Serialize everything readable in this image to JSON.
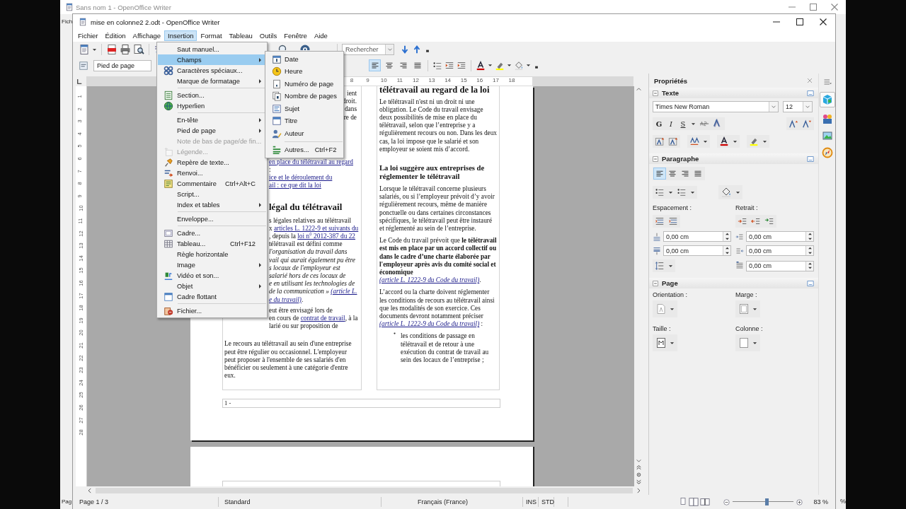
{
  "background_window": {
    "title": "Sans nom 1 - OpenOffice Writer",
    "menu_fragment": "Fich",
    "status_fragment": "Pag",
    "zoom_fragment": "%"
  },
  "window": {
    "title": "mise en colonne2 2.odt - OpenOffice Writer"
  },
  "menubar": [
    {
      "label": "Fichier",
      "selected": false
    },
    {
      "label": "Édition",
      "selected": false
    },
    {
      "label": "Affichage",
      "selected": false
    },
    {
      "label": "Insertion",
      "selected": true
    },
    {
      "label": "Format",
      "selected": false
    },
    {
      "label": "Tableau",
      "selected": false
    },
    {
      "label": "Outils",
      "selected": false
    },
    {
      "label": "Fenêtre",
      "selected": false
    },
    {
      "label": "Aide",
      "selected": false
    }
  ],
  "toolbar": {
    "paragraph_style": "Pied de page",
    "search": {
      "placeholder": "Rechercher"
    },
    "alignment": [
      {
        "selected": true
      },
      {
        "selected": false
      },
      {
        "selected": false
      },
      {
        "selected": false
      }
    ]
  },
  "insert_menu": [
    {
      "kind": "item",
      "label": "Saut manuel...",
      "icon": false,
      "selected": false,
      "disabled": false
    },
    {
      "kind": "submenu",
      "label": "Champs",
      "icon": false,
      "selected": true,
      "disabled": false
    },
    {
      "kind": "item",
      "label": "Caractères spéciaux...",
      "icon": true,
      "selected": false,
      "disabled": false
    },
    {
      "kind": "submenu",
      "label": "Marque de formatage",
      "icon": false,
      "selected": false,
      "disabled": false
    },
    {
      "kind": "separator"
    },
    {
      "kind": "item",
      "label": "Section...",
      "icon": true,
      "selected": false,
      "disabled": false
    },
    {
      "kind": "item",
      "label": "Hyperlien",
      "icon": true,
      "selected": false,
      "disabled": false
    },
    {
      "kind": "separator"
    },
    {
      "kind": "submenu",
      "label": "En-tête",
      "icon": false,
      "selected": false,
      "disabled": false
    },
    {
      "kind": "submenu",
      "label": "Pied de page",
      "icon": false,
      "selected": false,
      "disabled": false
    },
    {
      "kind": "item",
      "label": "Note de bas de page/de fin...",
      "icon": false,
      "selected": false,
      "disabled": true
    },
    {
      "kind": "item",
      "label": "Légende...",
      "icon": true,
      "selected": false,
      "disabled": true
    },
    {
      "kind": "item",
      "label": "Repère de texte...",
      "icon": true,
      "selected": false,
      "disabled": false
    },
    {
      "kind": "item",
      "label": "Renvoi...",
      "icon": true,
      "selected": false,
      "disabled": false
    },
    {
      "kind": "item",
      "label": "Commentaire",
      "shortcut": "Ctrl+Alt+C",
      "icon": true,
      "selected": false,
      "disabled": false
    },
    {
      "kind": "item",
      "label": "Script...",
      "icon": false,
      "selected": false,
      "disabled": false
    },
    {
      "kind": "submenu",
      "label": "Index et tables",
      "icon": false,
      "selected": false,
      "disabled": false
    },
    {
      "kind": "separator"
    },
    {
      "kind": "item",
      "label": "Enveloppe...",
      "icon": false,
      "selected": false,
      "disabled": false
    },
    {
      "kind": "separator"
    },
    {
      "kind": "item",
      "label": "Cadre...",
      "icon": true,
      "selected": false,
      "disabled": false
    },
    {
      "kind": "item",
      "label": "Tableau...",
      "shortcut": "Ctrl+F12",
      "icon": true,
      "selected": false,
      "disabled": false
    },
    {
      "kind": "item",
      "label": "Règle horizontale",
      "icon": false,
      "selected": false,
      "disabled": false
    },
    {
      "kind": "submenu",
      "label": "Image",
      "icon": false,
      "selected": false,
      "disabled": false
    },
    {
      "kind": "item",
      "label": "Vidéo et son...",
      "icon": true,
      "selected": false,
      "disabled": false
    },
    {
      "kind": "submenu",
      "label": "Objet",
      "icon": false,
      "selected": false,
      "disabled": false
    },
    {
      "kind": "item",
      "label": "Cadre flottant",
      "icon": true,
      "selected": false,
      "disabled": false
    },
    {
      "kind": "separator"
    },
    {
      "kind": "item",
      "label": "Fichier...",
      "icon": true,
      "selected": false,
      "disabled": false
    }
  ],
  "fields_menu": [
    {
      "kind": "item",
      "label": "Date",
      "icon": true,
      "selected": false,
      "disabled": false
    },
    {
      "kind": "item",
      "label": "Heure",
      "icon": true,
      "selected": false,
      "disabled": false
    },
    {
      "kind": "item",
      "label": "Numéro de page",
      "icon": true,
      "selected": false,
      "disabled": false
    },
    {
      "kind": "item",
      "label": "Nombre de pages",
      "icon": true,
      "selected": false,
      "disabled": false
    },
    {
      "kind": "item",
      "label": "Sujet",
      "icon": true,
      "selected": false,
      "disabled": false
    },
    {
      "kind": "item",
      "label": "Titre",
      "icon": true,
      "selected": false,
      "disabled": false
    },
    {
      "kind": "item",
      "label": "Auteur",
      "icon": true,
      "selected": false,
      "disabled": false
    },
    {
      "kind": "separator"
    },
    {
      "kind": "item",
      "label": "Autres...",
      "shortcut": "Ctrl+F2",
      "icon": true,
      "selected": false,
      "disabled": false
    }
  ],
  "ruler": {
    "labels": [
      "8",
      "9",
      "10",
      "11",
      "12",
      "13",
      "14",
      "15",
      "16",
      "17",
      "18"
    ]
  },
  "vertical_ruler": {
    "labels": [
      "1",
      "2",
      "3",
      "4",
      "5",
      "6",
      "7",
      "8",
      "9",
      "10",
      "11",
      "12",
      "13",
      "14",
      "15",
      "16",
      "17",
      "18",
      "19",
      "20",
      "21",
      "22",
      "23",
      "24",
      "25",
      "26",
      "27",
      "28"
    ]
  },
  "document": {
    "left_column": [
      {
        "kind": "fragment_right",
        "lines": [
          [
            {
              "text": "ient",
              "kind": "plain"
            }
          ],
          [
            {
              "text": "droit.",
              "kind": "plain"
            }
          ],
          [
            {
              "text": "dans",
              "kind": "plain"
            }
          ],
          [
            {
              "text": "re de",
              "kind": "plain"
            }
          ]
        ]
      },
      {
        "kind": "fragment_left",
        "lines": [
          [
            {
              "text": "en place du télétravail au regard",
              "kind": "link"
            }
          ],
          [
            {
              "text": ":",
              "kind": "plain"
            }
          ],
          [
            {
              "text": "ice et le déroulement du",
              "kind": "link"
            }
          ],
          [
            {
              "text": "ail : ce que dit la loi",
              "kind": "link"
            }
          ]
        ]
      },
      {
        "kind": "heading_fragment",
        "lines": [
          [
            {
              "text": "légal du télétravail",
              "kind": "plain"
            }
          ]
        ]
      },
      {
        "kind": "fragment_left",
        "lines": [
          [
            {
              "text": "s légales relatives au télétravail",
              "kind": "plain"
            }
          ],
          [
            {
              "text": "x ",
              "kind": "plain"
            },
            {
              "text": "articles L. 1222-9 et suivants du",
              "kind": "link"
            }
          ],
          [
            {
              "text": ", depuis la ",
              "kind": "plain"
            },
            {
              "text": "loi n° 2012-387 du 22",
              "kind": "link"
            }
          ],
          [
            {
              "text": "télétravail est défini comme",
              "kind": "plain"
            }
          ],
          [
            {
              "text": "l'organisation du travail dans",
              "kind": "italic"
            }
          ],
          [
            {
              "text": "vail qui aurait également pu être",
              "kind": "italic"
            }
          ],
          [
            {
              "text": "s locaux de l'employeur est",
              "kind": "italic"
            }
          ],
          [
            {
              "text": "salarié hors de ces locaux de",
              "kind": "italic"
            }
          ],
          [
            {
              "text": "e en utilisant les technologies de",
              "kind": "italic"
            }
          ],
          [
            {
              "text": "de la communication » ",
              "kind": "italic"
            },
            {
              "text": "(article L.",
              "kind": "italic_link"
            }
          ],
          [
            {
              "text": "e du travail)",
              "kind": "italic_link"
            },
            {
              "text": ".",
              "kind": "plain"
            }
          ]
        ]
      },
      {
        "kind": "fragment_left",
        "lines": [
          [
            {
              "text": "eut être envisagé lors de",
              "kind": "plain"
            }
          ],
          [
            {
              "text": "en cours de ",
              "kind": "plain"
            },
            {
              "text": "contrat de travail",
              "kind": "link"
            },
            {
              "text": ", à la",
              "kind": "plain"
            }
          ],
          [
            {
              "text": "larié ou sur proposition de",
              "kind": "plain"
            }
          ]
        ]
      },
      {
        "kind": "paragraph",
        "lines": [
          [
            {
              "text": "Le recours au télétravail au sein d'une entreprise peut être régulier ou occasionnel. L'employeur peut proposer à l'ensemble de ses salariés d'en bénéficier ou seulement à une catégorie d'entre eux.",
              "kind": "plain"
            }
          ]
        ]
      }
    ],
    "right_column": [
      {
        "kind": "heading",
        "segments": [
          {
            "text": "télétravail au regard de la loi",
            "kind": "plain"
          }
        ]
      },
      {
        "kind": "paragraph",
        "segments": [
          {
            "text": "Le télétravail n'est ni un droit ni une obligation. Le Code du travail envisage deux possibilités de mise en place du télétravail, selon que l’entreprise y a régulièrement recours ou non. Dans les deux cas, la loi impose que le salarié et son employeur se soient mis d’accord.",
            "kind": "plain"
          }
        ]
      },
      {
        "kind": "subheading",
        "segments": [
          {
            "text": "La loi suggère aux entreprises de réglementer le télétravail",
            "kind": "plain"
          }
        ]
      },
      {
        "kind": "paragraph",
        "segments": [
          {
            "text": "Lorsque le télétravail concerne plusieurs salariés, ou si l’employeur prévoit d’y avoir régulièrement recours, même de manière ponctuelle ou dans certaines circonstances spécifiques, le télétravail peut être instauré et réglementé au sein de l’entreprise.",
            "kind": "plain"
          }
        ]
      },
      {
        "kind": "paragraph",
        "segments": [
          {
            "text": "Le Code du travail prévoit que ",
            "kind": "plain"
          },
          {
            "text": "le télétravail est mis en place par un accord collectif ou dans le cadre d’une charte élaborée par l'employeur après avis du comité social et économique ",
            "kind": "bold"
          },
          {
            "text": "(article L. 1222-9 du Code du travail)",
            "kind": "italic_link"
          },
          {
            "text": ".",
            "kind": "plain"
          }
        ]
      },
      {
        "kind": "paragraph",
        "segments": [
          {
            "text": "L’accord ou la charte doivent réglementer les conditions de recours au télétravail ainsi que les modalités de son exercice. Ces documents devront notamment préciser ",
            "kind": "plain"
          },
          {
            "text": "(article L. 1222-9 du Code du travail)",
            "kind": "italic_link"
          },
          {
            "text": " :",
            "kind": "plain"
          }
        ]
      },
      {
        "kind": "bullet",
        "segments": [
          {
            "text": "les conditions de passage en télétravail et de retour à une exécution du contrat de travail au sein des locaux de l’entreprise ;",
            "kind": "plain"
          }
        ]
      }
    ],
    "footer": "1 -"
  },
  "sidebar": {
    "title": "Propriétés",
    "text_section": {
      "title": "Texte",
      "font": "Times New Roman",
      "size": "12",
      "buttons": [
        "G",
        "I",
        "S"
      ]
    },
    "paragraph_section": {
      "title": "Paragraphe",
      "alignment": [
        {
          "selected": true
        },
        {
          "selected": false
        },
        {
          "selected": false
        },
        {
          "selected": false
        }
      ],
      "spacing_label": "Espacement :",
      "indent_label": "Retrait :",
      "spacing_fields": [
        "0,00 cm",
        "0,00 cm"
      ],
      "indent_fields": [
        "0,00 cm",
        "0,00 cm",
        "0,00 cm"
      ]
    },
    "page_section": {
      "title": "Page",
      "labels": [
        "Orientation :",
        "Marge :",
        "Taille :",
        "Colonne :"
      ]
    }
  },
  "status_bar": {
    "page": "Page 1 / 3",
    "style": "Standard",
    "language": "Français (France)",
    "insert_mode": "INS",
    "selection_mode": "STD",
    "zoom": "83 %",
    "zoom_slider": {
      "level": 0.55
    }
  }
}
